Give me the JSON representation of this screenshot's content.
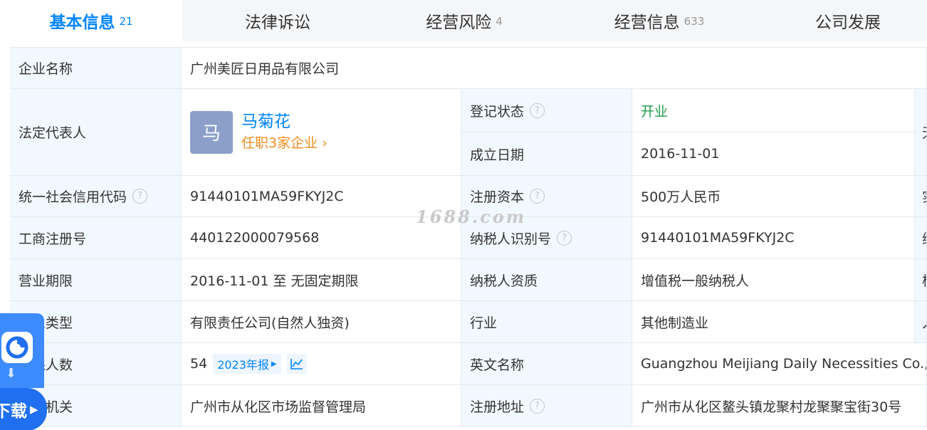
{
  "tabs": [
    {
      "label": "基本信息",
      "count": "21"
    },
    {
      "label": "法律诉讼",
      "count": ""
    },
    {
      "label": "经营风险",
      "count": "4"
    },
    {
      "label": "经营信息",
      "count": "633"
    },
    {
      "label": "公司发展",
      "count": ""
    }
  ],
  "company": {
    "name_label": "企业名称",
    "name_value": "广州美匠日用品有限公司",
    "rep_label": "法定代表人",
    "rep_avatar": "马",
    "rep_name": "马菊花",
    "rep_link": "任职3家企业",
    "rep_link_arrow": "›",
    "status_label": "登记状态",
    "status_value": "开业",
    "found_label": "成立日期",
    "found_value": "2016-11-01",
    "credit_label": "统一社会信用代码",
    "credit_value": "91440101MA59FKYJ2C",
    "capital_label": "注册资本",
    "capital_value": "500万人民币",
    "reg_no_label": "工商注册号",
    "reg_no_value": "440122000079568",
    "taxid_label": "纳税人识别号",
    "taxid_value": "91440101MA59FKYJ2C",
    "period_label": "营业期限",
    "period_value": "2016-11-01 至 无固定期限",
    "taxqual_label": "纳税人资质",
    "taxqual_value": "增值税一般纳税人",
    "type_label": "企业类型",
    "type_value": "有限责任公司(自然人独资)",
    "industry_label": "行业",
    "industry_value": "其他制造业",
    "insured_label": "参保人数",
    "insured_value": "54",
    "insured_badge": "2023年报",
    "english_label": "英文名称",
    "english_value": "Guangzhou Meijiang Daily Necessities Co., Ltd.",
    "authority_label": "登记机关",
    "authority_value": "广州市从化区市场监督管理局",
    "address_label": "注册地址",
    "address_value": "广州市从化区鳌头镇龙聚村龙聚聚宝街30号"
  },
  "right_edge": [
    "无",
    "实",
    "纳",
    "核",
    "人"
  ],
  "watermark": "1688.com",
  "app": {
    "download_label": "下载"
  },
  "colors": {
    "accent": "#0084ff",
    "label_bg": "#f2f8ff",
    "status_green": "#1b9e4b",
    "link_orange": "#f08c1e"
  }
}
